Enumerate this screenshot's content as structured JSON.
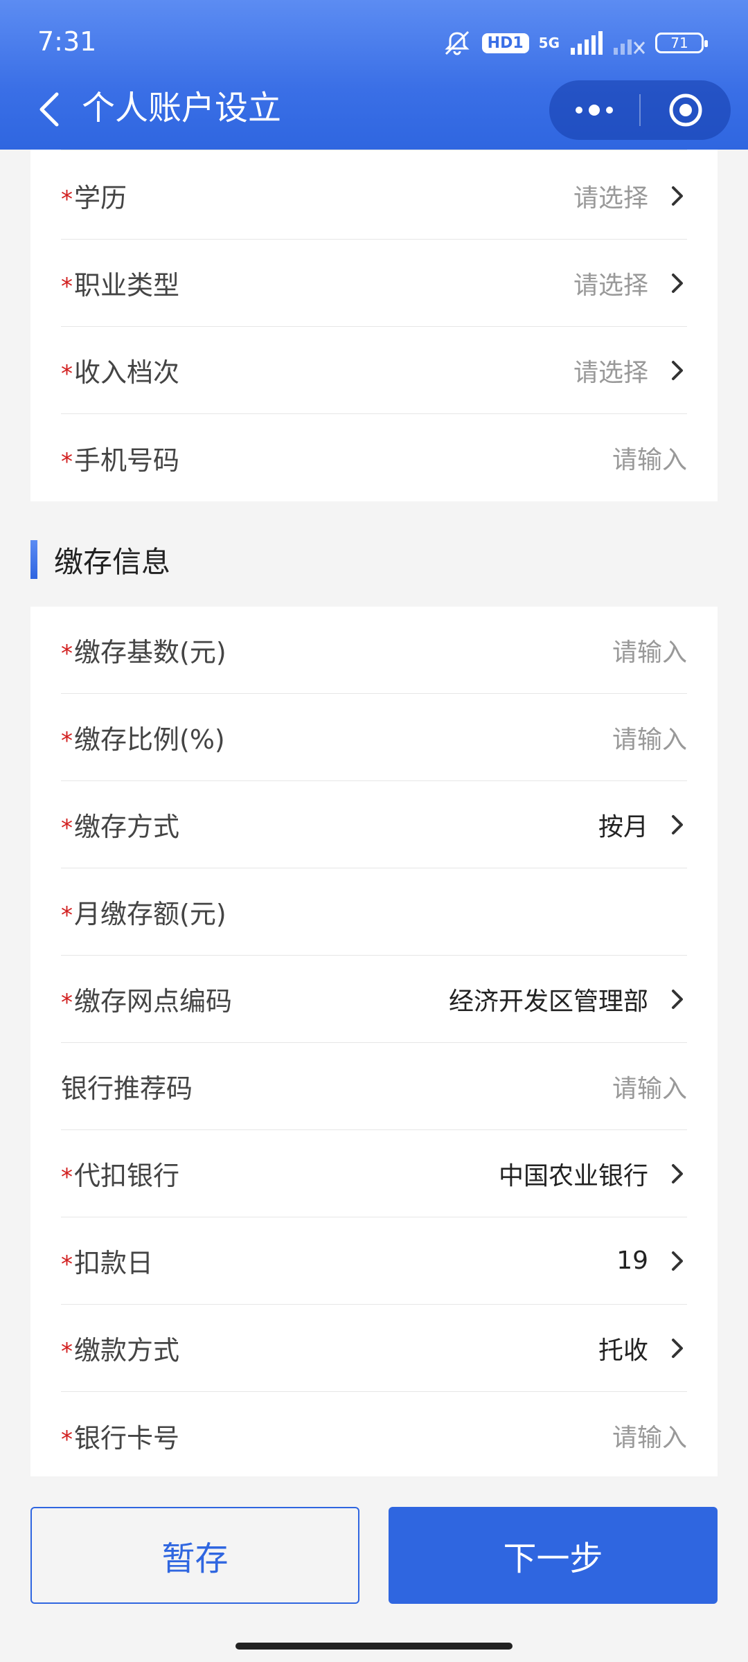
{
  "status": {
    "time": "7:31",
    "hd": "HD1",
    "network": "5G",
    "battery": "71"
  },
  "nav": {
    "title": "个人账户设立"
  },
  "required_mark": "*",
  "top_fields": [
    {
      "label": "学历",
      "required": true,
      "value": "请选择",
      "placeholder": true,
      "chevron": true
    },
    {
      "label": "职业类型",
      "required": true,
      "value": "请选择",
      "placeholder": true,
      "chevron": true
    },
    {
      "label": "收入档次",
      "required": true,
      "value": "请选择",
      "placeholder": true,
      "chevron": true
    },
    {
      "label": "手机号码",
      "required": true,
      "value": "请输入",
      "placeholder": true,
      "chevron": false
    }
  ],
  "section": {
    "title": "缴存信息"
  },
  "deposit_fields": [
    {
      "label": "缴存基数(元)",
      "required": true,
      "value": "请输入",
      "placeholder": true,
      "chevron": false
    },
    {
      "label": "缴存比例(%)",
      "required": true,
      "value": "请输入",
      "placeholder": true,
      "chevron": false
    },
    {
      "label": "缴存方式",
      "required": true,
      "value": "按月",
      "placeholder": false,
      "chevron": true
    },
    {
      "label": "月缴存额(元)",
      "required": true,
      "value": "",
      "placeholder": false,
      "chevron": false
    },
    {
      "label": "缴存网点编码",
      "required": true,
      "value": "经济开发区管理部",
      "placeholder": false,
      "chevron": true
    },
    {
      "label": "银行推荐码",
      "required": false,
      "value": "请输入",
      "placeholder": true,
      "chevron": false
    },
    {
      "label": "代扣银行",
      "required": true,
      "value": "中国农业银行",
      "placeholder": false,
      "chevron": true
    },
    {
      "label": "扣款日",
      "required": true,
      "value": "19",
      "placeholder": false,
      "chevron": true
    },
    {
      "label": "缴款方式",
      "required": true,
      "value": "托收",
      "placeholder": false,
      "chevron": true
    },
    {
      "label": "银行卡号",
      "required": true,
      "value": "请输入",
      "placeholder": true,
      "chevron": false
    }
  ],
  "buttons": {
    "save": "暂存",
    "next": "下一步"
  },
  "colors": {
    "primary": "#2f66e0",
    "required": "#d22020",
    "placeholder": "#999999"
  },
  "icons": {
    "back": "chevron-left-icon",
    "more": "more-dots-icon",
    "close": "target-circle-icon",
    "chevron": "chevron-right-icon",
    "mute": "muted-bell-icon",
    "signal": "signal-bars-icon",
    "battery": "battery-icon"
  }
}
